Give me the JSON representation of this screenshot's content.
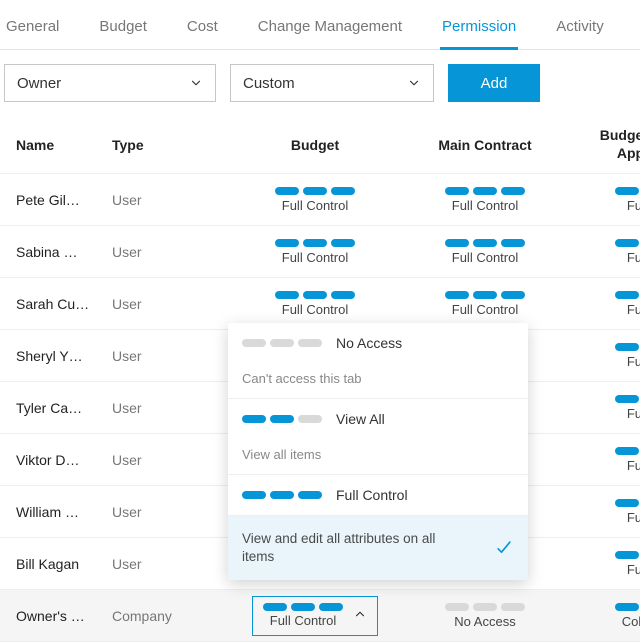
{
  "tabs": {
    "general": "General",
    "budget": "Budget",
    "cost": "Cost",
    "change": "Change Management",
    "permission": "Permission",
    "activity": "Activity"
  },
  "controls": {
    "owner_label": "Owner",
    "custom_label": "Custom",
    "add_label": "Add"
  },
  "columns": {
    "name": "Name",
    "type": "Type",
    "budget": "Budget",
    "contract": "Main Contract",
    "app": "Budget Payment Application"
  },
  "perm": {
    "full": "Full Control",
    "none_label": "No Access",
    "collab": "Collaborate",
    "full_contr_short": "Full Contr"
  },
  "rows": [
    {
      "name": "Pete Gil…",
      "type": "User"
    },
    {
      "name": "Sabina …",
      "type": "User"
    },
    {
      "name": "Sarah Cu…",
      "type": "User"
    },
    {
      "name": "Sheryl Y…",
      "type": "User"
    },
    {
      "name": "Tyler Ca…",
      "type": "User"
    },
    {
      "name": "Viktor D…",
      "type": "User"
    },
    {
      "name": "William …",
      "type": "User"
    },
    {
      "name": "Bill Kagan",
      "type": "User"
    },
    {
      "name": "Owner's …",
      "type": "Company"
    }
  ],
  "popover": {
    "no_access": "No Access",
    "no_access_desc": "Can't access this tab",
    "view_all": "View All",
    "view_all_desc": "View all items",
    "full_control": "Full Control",
    "selected_desc": "View and edit all attributes on all items"
  }
}
